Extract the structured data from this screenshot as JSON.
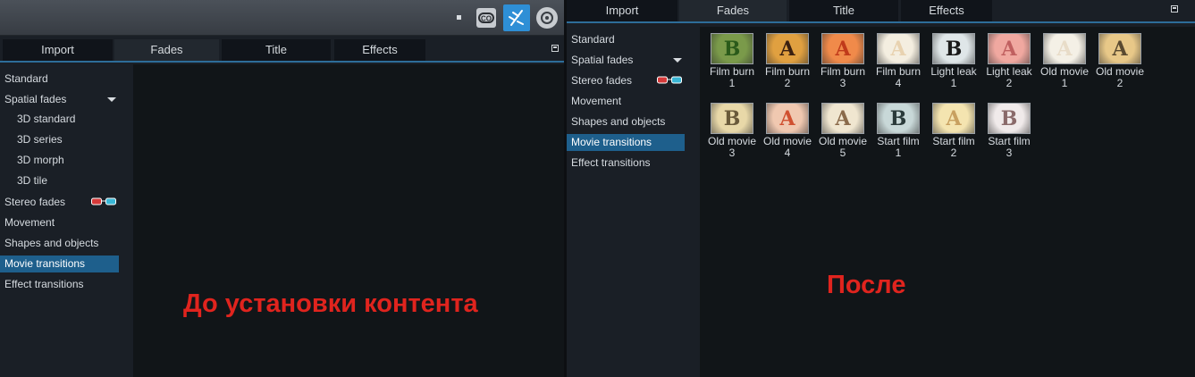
{
  "tabs": [
    "Import",
    "Fades",
    "Title",
    "Effects"
  ],
  "left_panel": {
    "categories": [
      {
        "label": "Standard"
      },
      {
        "label": "Spatial fades"
      },
      {
        "label": "3D standard"
      },
      {
        "label": "3D series"
      },
      {
        "label": "3D morph"
      },
      {
        "label": "3D tile"
      },
      {
        "label": "Stereo fades"
      },
      {
        "label": "Movement"
      },
      {
        "label": "Shapes and objects"
      },
      {
        "label": "Movie transitions"
      },
      {
        "label": "Effect transitions"
      }
    ],
    "caption": "До установки контента"
  },
  "right_panel": {
    "categories": [
      {
        "label": "Standard"
      },
      {
        "label": "Spatial fades"
      },
      {
        "label": "Stereo fades"
      },
      {
        "label": "Movement"
      },
      {
        "label": "Shapes and objects"
      },
      {
        "label": "Movie transitions"
      },
      {
        "label": "Effect transitions"
      }
    ],
    "caption": "После",
    "thumbnails": [
      {
        "line1": "Film burn",
        "line2": "1",
        "letter": "B",
        "bg": "#7a9a4a",
        "fg": "#2a5a1a"
      },
      {
        "line1": "Film burn",
        "line2": "2",
        "letter": "A",
        "bg": "#e0a040",
        "fg": "#3a2010"
      },
      {
        "line1": "Film burn",
        "line2": "3",
        "letter": "A",
        "bg": "#f08a4a",
        "fg": "#c03a1a"
      },
      {
        "line1": "Film burn",
        "line2": "4",
        "letter": "A",
        "bg": "#f4eee0",
        "fg": "#e8d2b0"
      },
      {
        "line1": "Light leak",
        "line2": "1",
        "letter": "B",
        "bg": "#dfe6e8",
        "fg": "#1a1a1a"
      },
      {
        "line1": "Light leak",
        "line2": "2",
        "letter": "A",
        "bg": "#f0a8a0",
        "fg": "#c06060"
      },
      {
        "line1": "Old movie",
        "line2": "1",
        "letter": "A",
        "bg": "#f4f0e6",
        "fg": "#e8dcc8"
      },
      {
        "line1": "Old movie",
        "line2": "2",
        "letter": "A",
        "bg": "#e8c888",
        "fg": "#5a4a30"
      },
      {
        "line1": "Old movie",
        "line2": "3",
        "letter": "B",
        "bg": "#e8d8a8",
        "fg": "#6a5a3a"
      },
      {
        "line1": "Old movie",
        "line2": "4",
        "letter": "A",
        "bg": "#f0c8b0",
        "fg": "#d05030"
      },
      {
        "line1": "Old movie",
        "line2": "5",
        "letter": "A",
        "bg": "#f0e6d0",
        "fg": "#8a6a4a"
      },
      {
        "line1": "Start film",
        "line2": "1",
        "letter": "B",
        "bg": "#c8d8d8",
        "fg": "#2a3a3a"
      },
      {
        "line1": "Start film",
        "line2": "2",
        "letter": "A",
        "bg": "#f4e4b0",
        "fg": "#c8a060"
      },
      {
        "line1": "Start film",
        "line2": "3",
        "letter": "B",
        "bg": "#f0eaea",
        "fg": "#8a6a6a"
      }
    ]
  }
}
